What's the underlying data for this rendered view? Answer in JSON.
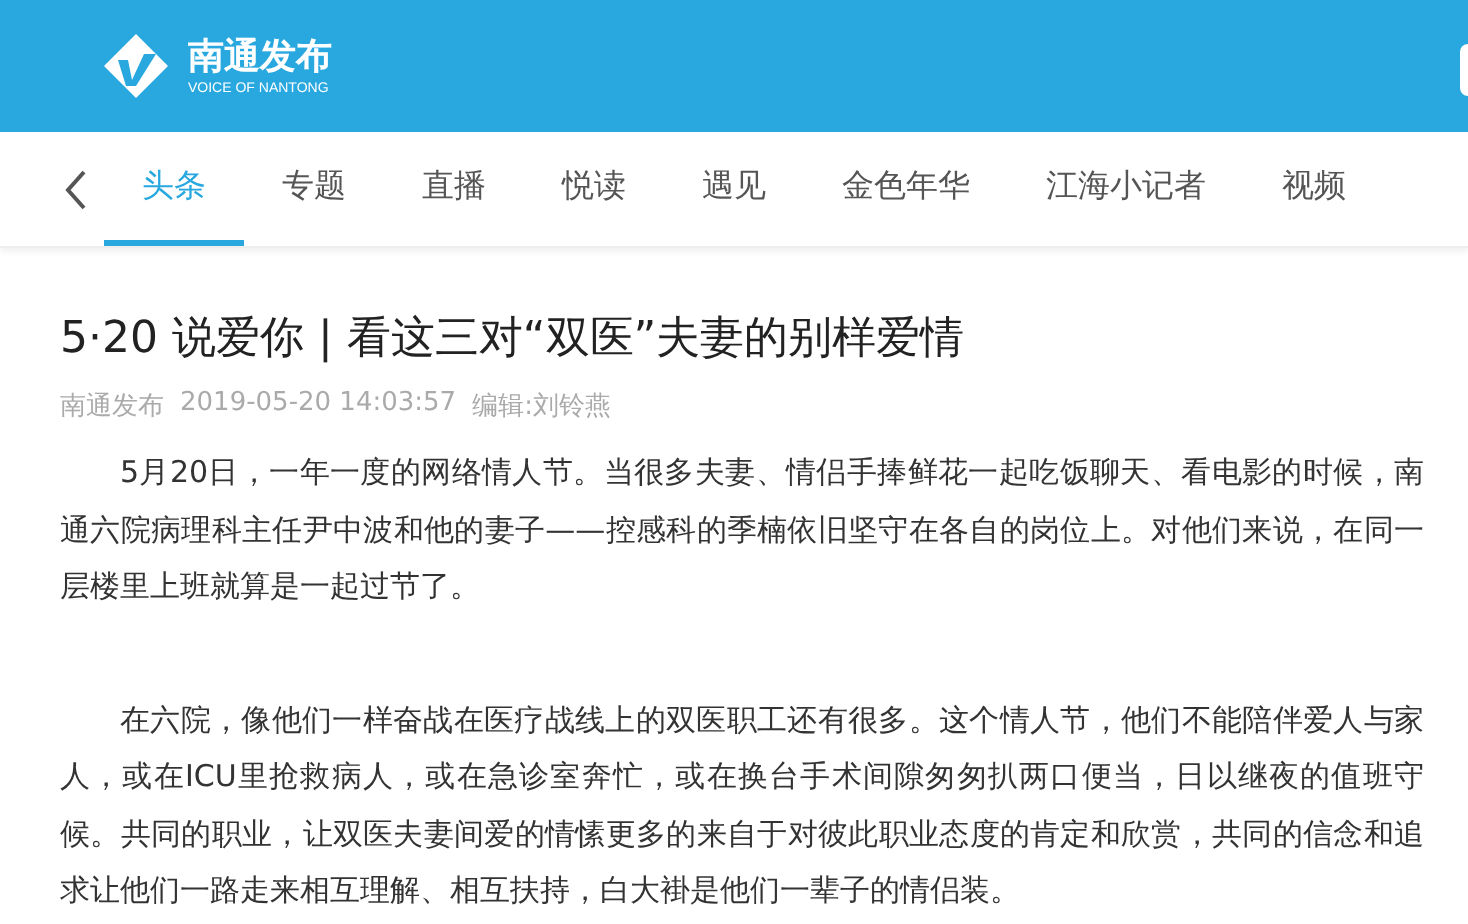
{
  "header": {
    "logo_title": "南通发布",
    "logo_subtitle": "VOICE OF NANTONG"
  },
  "nav": {
    "tabs": [
      {
        "label": "头条",
        "selected": true
      },
      {
        "label": "专题",
        "selected": false
      },
      {
        "label": "直播",
        "selected": false
      },
      {
        "label": "悦读",
        "selected": false
      },
      {
        "label": "遇见",
        "selected": false
      },
      {
        "label": "金色年华",
        "selected": false
      },
      {
        "label": "江海小记者",
        "selected": false
      },
      {
        "label": "视频",
        "selected": false
      }
    ]
  },
  "article": {
    "title": "5·20 说爱你 | 看这三对“双医”夫妻的别样爱情",
    "source": "南通发布",
    "time": "2019-05-20 14:03:57",
    "editor": "编辑:刘铃燕",
    "paragraphs": [
      "5月20日，一年一度的网络情人节。当很多夫妻、情侣手捧鲜花一起吃饭聊天、看电影的时候，南通六院病理科主任尹中波和他的妻子——控感科的季楠依旧坚守在各自的岗位上。对他们来说，在同一层楼里上班就算是一起过节了。",
      "在六院，像他们一样奋战在医疗战线上的双医职工还有很多。这个情人节，他们不能陪伴爱人与家人，或在ICU里抢救病人，或在急诊室奔忙，或在换台手术间隙匆匆扒两口便当，日以继夜的值班守候。共同的职业，让双医夫妻间爱的情愫更多的来自于对彼此职业态度的肯定和欣赏，共同的信念和追求让他们一路走来相互理解、相互扶持，白大褂是他们一辈子的情侣装。"
    ]
  }
}
